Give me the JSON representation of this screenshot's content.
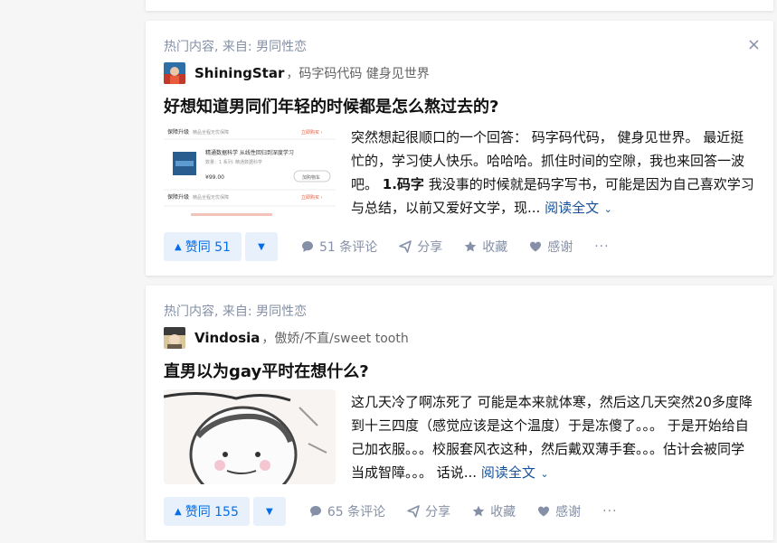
{
  "feed": [
    {
      "source": "热门内容, 来自: 男同性恋",
      "close_icon": "×",
      "author": {
        "name": "ShiningStar",
        "bio": "，码字码代码 健身见世界"
      },
      "title": "好想知道男同们年轻的时候都是怎么熬过去的?",
      "thumbnail": {
        "row1_tag": "保障升级",
        "row1_text": "精品全程无忧保障",
        "row1_link": "立即购买 ›",
        "book_title": "精通数据科学 从线性回归到深度学习",
        "book_meta": "数量：1 系列: 精通数据科学",
        "book_price": "¥99.00",
        "book_button": "加购物车",
        "row3_tag": "保障升级",
        "row3_text": "精品全程无忧保障",
        "row3_link": "立即购买 ›"
      },
      "excerpt_lead": "突然想起很顺口的一个回答： 码字码代码， 健身见世界。 最近挺忙的，学习使人快乐。哈哈哈。抓住时间的空隙，我也来回答一波吧。 ",
      "excerpt_bold": "1.码字",
      "excerpt_tail": " 我没事的时候就是码字写书，可能是因为自己喜欢学习与总结，以前又爱好文学，现... ",
      "read_more": "阅读全文",
      "vote_label": "赞同 51",
      "comments": "51 条评论",
      "share": "分享",
      "favorite": "收藏",
      "thanks": "感谢",
      "more": "···"
    },
    {
      "source": "热门内容, 来自: 男同性恋",
      "author": {
        "name": "Vindosia",
        "bio": "，傲娇/不直/sweet tooth"
      },
      "title": "直男以为gay平时在想什么?",
      "excerpt_lead": "这几天冷了啊冻死了 可能是本来就体寒，然后这几天突然20多度降到十三四度（感觉应该是这个温度）于是冻傻了。。。 于是开始给自己加衣服。。。校服套风衣这种，然后戴双薄手套。。。估计会被同学当成智障。。。 话说... ",
      "read_more": "阅读全文",
      "vote_label": "赞同 155",
      "comments": "65 条评论",
      "share": "分享",
      "favorite": "收藏",
      "thanks": "感谢",
      "more": "···"
    }
  ],
  "colors": {
    "accent": "#056de8",
    "accent_bg": "#e8f1fb",
    "muted": "#8590a6",
    "link": "#175199"
  },
  "icons": [
    "close-icon",
    "vote-up-icon",
    "vote-down-icon",
    "comment-icon",
    "share-icon",
    "star-icon",
    "heart-icon",
    "more-icon",
    "chevron-down-icon"
  ]
}
